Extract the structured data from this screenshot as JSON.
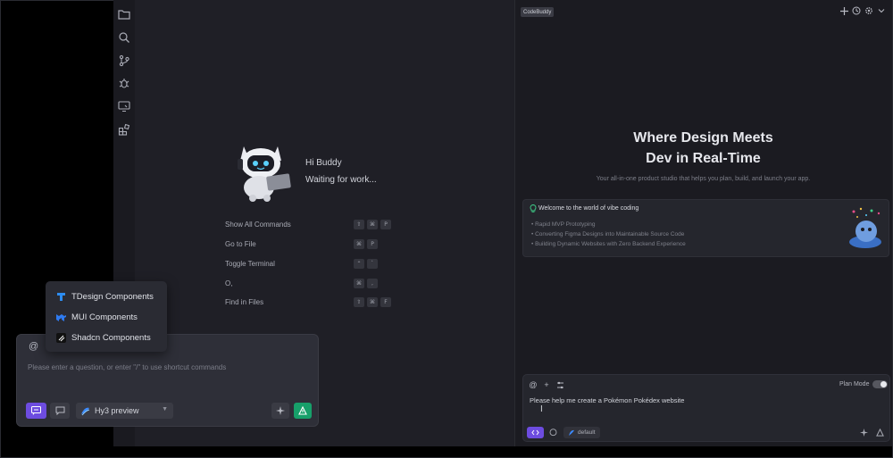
{
  "activity_bar": {
    "icons": [
      "folder-icon",
      "search-icon",
      "source-control-icon",
      "debug-icon",
      "remote-icon",
      "extensions-icon"
    ]
  },
  "editor": {
    "greeting": "Hi Buddy",
    "status": "Waiting for work...",
    "commands": [
      {
        "label": "Show All Commands",
        "keys": [
          "⇧",
          "⌘",
          "P"
        ]
      },
      {
        "label": "Go to File",
        "keys": [
          "⌘",
          "P"
        ]
      },
      {
        "label": "Toggle Terminal",
        "keys": [
          "⌃",
          "`"
        ]
      },
      {
        "label": "O,",
        "keys": [
          "⌘",
          ","
        ]
      },
      {
        "label": "Find in Files",
        "keys": [
          "⇧",
          "⌘",
          "F"
        ]
      }
    ]
  },
  "component_menu": {
    "items": [
      {
        "label": "TDesign Components",
        "icon": "tdesign-icon"
      },
      {
        "label": "MUI Components",
        "icon": "mui-icon"
      },
      {
        "label": "Shadcn Components",
        "icon": "shadcn-icon"
      }
    ]
  },
  "left_chat": {
    "at_symbol": "@",
    "placeholder": "Please enter a question, or enter \"/\" to use shortcut commands",
    "model": "Hy3 preview"
  },
  "right_panel": {
    "tag": "CodeBuddy",
    "hero_line1": "Where Design Meets",
    "hero_line2": "Dev in Real-Time",
    "subtitle": "Your all-in-one product studio that helps you plan, build, and launch your app.",
    "welcome_title": "Welcome to the world of vibe coding",
    "bullets": [
      "Rapid MVP Prototyping",
      "Converting Figma Designs into Maintainable Source Code",
      "Building Dynamic Websites with Zero Backend Experience"
    ],
    "plan_mode_label": "Plan Mode",
    "input_text": "Please help me create a Pokémon Pokédex website",
    "agent_label": "default"
  },
  "colors": {
    "accent_purple": "#6d4ce0",
    "send_green": "#17a06a",
    "panel_bg": "#1f1f26"
  }
}
